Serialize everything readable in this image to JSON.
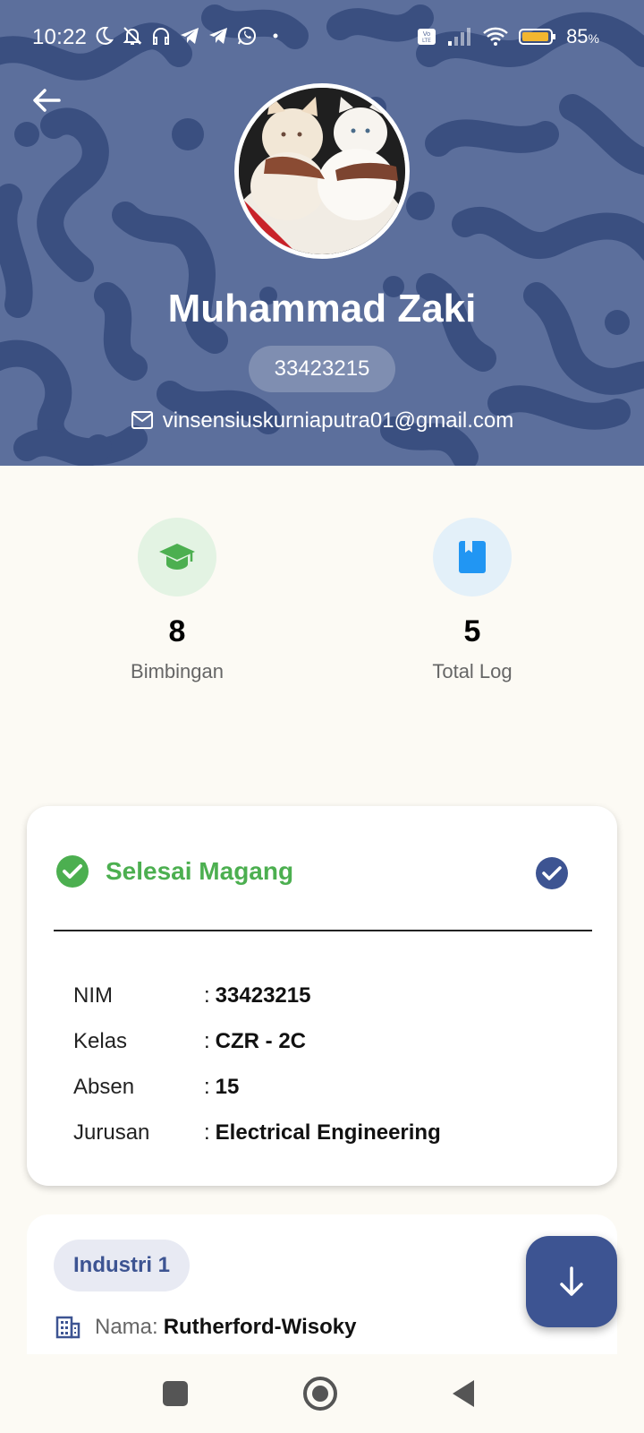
{
  "status_bar": {
    "time": "10:22",
    "battery_percent": "85",
    "battery_unit": "%",
    "network_badge": "Vo LTE",
    "left_icons": [
      "moon-icon",
      "bell-off-icon",
      "headset-icon",
      "telegram-icon",
      "telegram-icon",
      "whatsapp-icon",
      "dot-icon"
    ],
    "right_icons": [
      "volte-icon",
      "signal-icon",
      "wifi-icon",
      "battery-icon"
    ]
  },
  "profile": {
    "name": "Muhammad Zaki",
    "nim": "33423215",
    "email": "vinsensiuskurniaputra01@gmail.com"
  },
  "stats": [
    {
      "value": "8",
      "label": "Bimbingan",
      "icon": "graduation-cap-icon",
      "color": "#4caf50",
      "bg": "#e3f3e3"
    },
    {
      "value": "5",
      "label": "Total Log",
      "icon": "book-icon",
      "color": "#2196f3",
      "bg": "#e3f0f9"
    }
  ],
  "internship": {
    "status": "Selesai Magang",
    "status_color": "#4caf50",
    "rows": [
      {
        "key": "NIM",
        "value": "33423215"
      },
      {
        "key": "Kelas",
        "value": "CZR - 2C"
      },
      {
        "key": "Absen",
        "value": "15"
      },
      {
        "key": "Jurusan",
        "value": "Electrical Engineering"
      }
    ],
    "separator": ":"
  },
  "industry": {
    "badge": "Industri 1",
    "name_label": "Nama:",
    "name_value": "Rutherford-Wisoky"
  },
  "colors": {
    "primary": "#3d5492",
    "header_bg": "#5c6f9c",
    "page_bg": "#fcfaf4"
  }
}
